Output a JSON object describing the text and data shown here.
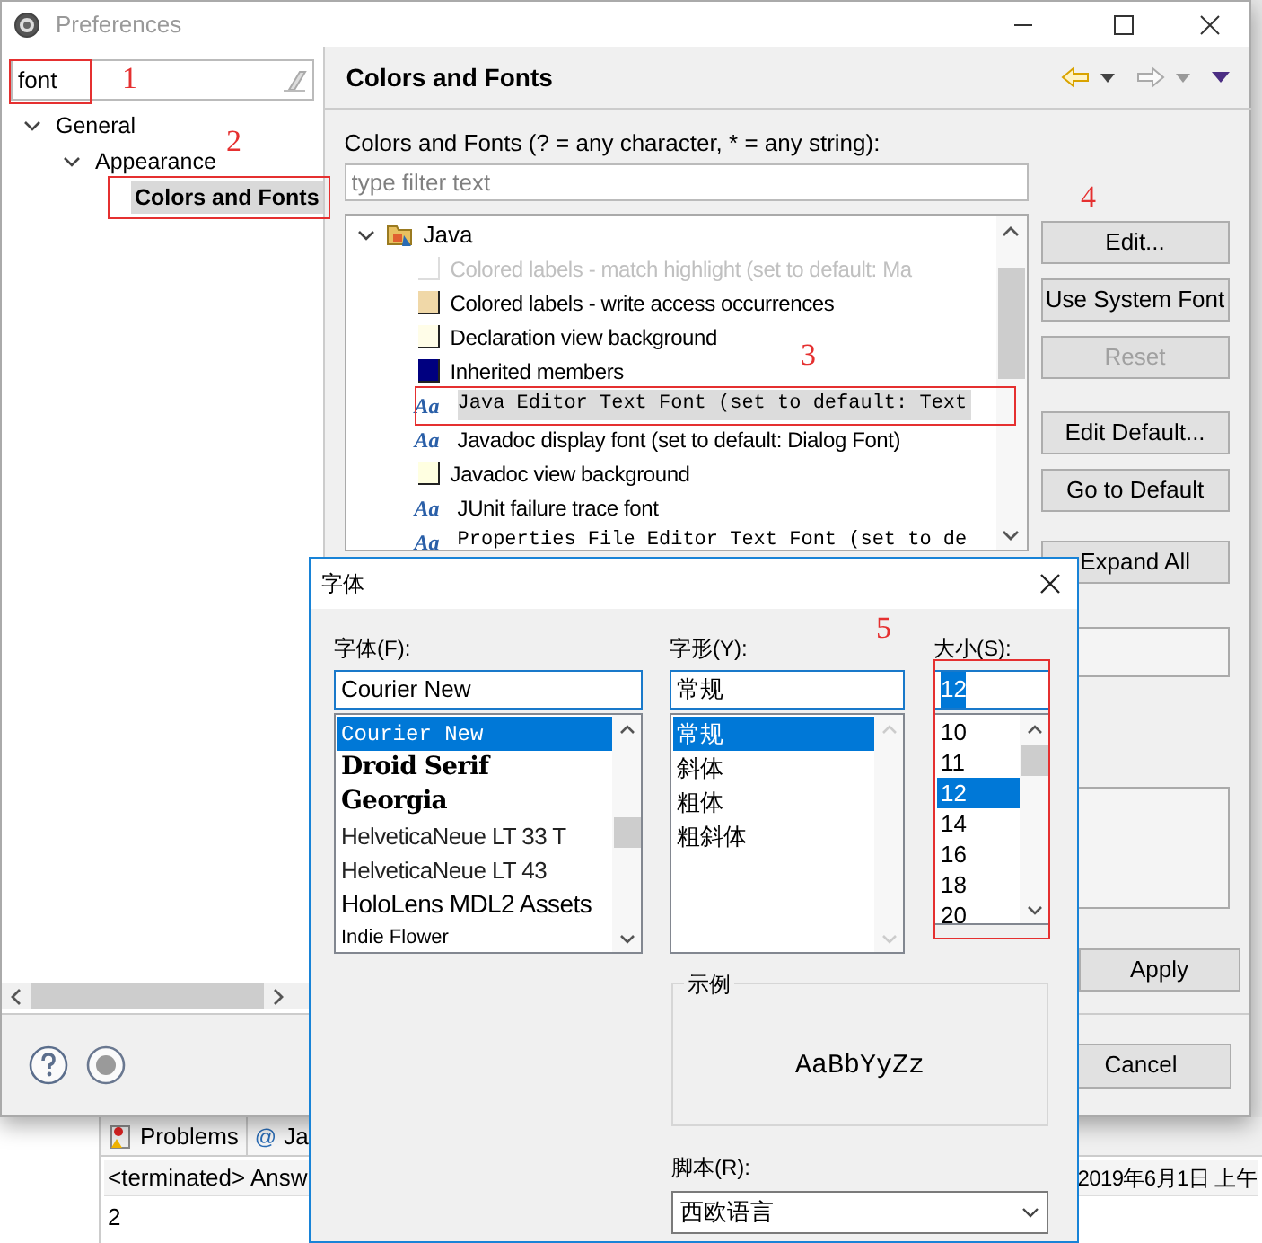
{
  "preferences": {
    "title": "Preferences",
    "filter": {
      "value": "font"
    },
    "nav_tree": [
      {
        "label": "General",
        "expanded": true,
        "selected": false,
        "children": [
          {
            "label": "Appearance",
            "expanded": true,
            "selected": false,
            "children": [
              {
                "label": "Colors and Fonts",
                "selected": true
              }
            ]
          }
        ]
      }
    ],
    "page_title": "Colors and Fonts",
    "description": "Colors and Fonts (? = any character, * = any string):",
    "filter_field": {
      "placeholder": "type filter text"
    },
    "tree": [
      {
        "label": "Java",
        "expanded": true,
        "children": [
          {
            "kind": "color",
            "label": "Colored labels - match highlight (set to default: Ma",
            "color": "#ffffff",
            "disabled": true,
            "selected": false,
            "monospace": false
          },
          {
            "kind": "color",
            "label": "Colored labels - write access occurrences",
            "color": "#f0d8a8",
            "disabled": false,
            "selected": false,
            "monospace": false
          },
          {
            "kind": "color",
            "label": "Declaration view background",
            "color": "#fffde8",
            "disabled": false,
            "selected": false,
            "monospace": false
          },
          {
            "kind": "color",
            "label": "Inherited members",
            "color": "#000080",
            "disabled": false,
            "selected": false,
            "monospace": false
          },
          {
            "kind": "font",
            "glyph": "Aa",
            "label": "Java Editor Text Font (set to default: Text",
            "disabled": false,
            "selected": true,
            "monospace": true
          },
          {
            "kind": "font",
            "glyph": "Aa",
            "label": "Javadoc display font (set to default: Dialog Font)",
            "disabled": false,
            "selected": false,
            "monospace": false
          },
          {
            "kind": "color",
            "label": "Javadoc view background",
            "color": "#ffffe1",
            "disabled": false,
            "selected": false,
            "monospace": false
          },
          {
            "kind": "font",
            "glyph": "Aa",
            "label": "JUnit failure trace font",
            "disabled": false,
            "selected": false,
            "monospace": false
          },
          {
            "kind": "font",
            "glyph": "Aa",
            "label": "Properties File Editor Text Font (set to de",
            "disabled": false,
            "selected": false,
            "monospace": true
          }
        ]
      }
    ],
    "buttons": [
      {
        "label": "Edit...",
        "disabled": false
      },
      {
        "label": "Use System Font",
        "disabled": false
      },
      {
        "label": "Reset",
        "disabled": true
      },
      {
        "label": "Edit Default...",
        "disabled": false
      },
      {
        "label": "Go to Default",
        "disabled": false
      },
      {
        "label": "Expand All",
        "disabled": false
      }
    ],
    "apply_button": "Apply",
    "cancel_button": "Cancel"
  },
  "font_dialog": {
    "title": "字体",
    "font": {
      "label": "字体(F):",
      "value": "Courier New",
      "items": [
        {
          "label": "Courier New",
          "kind": "mono",
          "selected": true
        },
        {
          "label": "Droid Serif",
          "kind": "serif-bold",
          "selected": false
        },
        {
          "label": "Georgia",
          "kind": "serif-bold",
          "selected": false
        },
        {
          "label": "HelveticaNeue LT 33 T",
          "kind": "light",
          "selected": false
        },
        {
          "label": "HelveticaNeue LT 43",
          "kind": "light",
          "selected": false
        },
        {
          "label": "HoloLens MDL2 Assets",
          "kind": "sans",
          "selected": false
        },
        {
          "label": "Indie Flower",
          "kind": "small",
          "selected": false
        }
      ]
    },
    "style": {
      "label": "字形(Y):",
      "value": "常规",
      "items": [
        {
          "label": "常规",
          "selected": true
        },
        {
          "label": "斜体",
          "selected": false
        },
        {
          "label": "粗体",
          "selected": false
        },
        {
          "label": "粗斜体",
          "selected": false
        }
      ]
    },
    "size": {
      "label": "大小(S):",
      "value": "12",
      "items": [
        {
          "label": "10",
          "selected": false
        },
        {
          "label": "11",
          "selected": false
        },
        {
          "label": "12",
          "selected": true
        },
        {
          "label": "14",
          "selected": false
        },
        {
          "label": "16",
          "selected": false
        },
        {
          "label": "18",
          "selected": false
        },
        {
          "label": "20",
          "selected": false
        }
      ]
    },
    "sample": {
      "label": "示例",
      "text": "AaBbYyZz"
    },
    "script": {
      "label": "脚本(R):",
      "value": "西欧语言"
    }
  },
  "background": {
    "tabs": [
      {
        "kind": "problems",
        "label": "Problems"
      },
      {
        "kind": "javadoc",
        "glyph": "@",
        "label": "Ja"
      }
    ],
    "console_header": "<terminated> Answ",
    "timestamp": "2019年6月1日 上午",
    "console_output": "2"
  },
  "annotations": [
    "1",
    "2",
    "3",
    "4",
    "5"
  ]
}
